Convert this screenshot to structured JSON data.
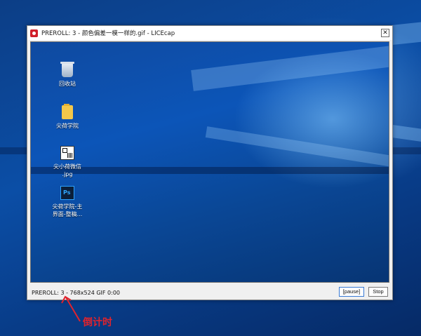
{
  "window": {
    "title": "PREROLL: 3 - 颜色偏差一模一样的.gif - LICEcap",
    "close_glyph": "✕"
  },
  "desktop_icons": [
    {
      "label_lines": [
        "回收站"
      ],
      "icon": "recycle-bin-icon"
    },
    {
      "label_lines": [
        "尖荷学院"
      ],
      "icon": "folder-icon"
    },
    {
      "label_lines": [
        "尖小荷微信",
        ".jpg"
      ],
      "icon": "qr-image-icon"
    },
    {
      "label_lines": [
        "尖荷学院-主",
        "界面-整稿..."
      ],
      "icon": "photoshop-file-icon",
      "badge": "Ps"
    }
  ],
  "statusbar": {
    "text": "PREROLL: 3 - 768x524 GIF 0:00",
    "pause_label": "[pause]",
    "stop_label": "Stop"
  },
  "annotation": {
    "label": "倒计时",
    "color": "#e0232d"
  }
}
